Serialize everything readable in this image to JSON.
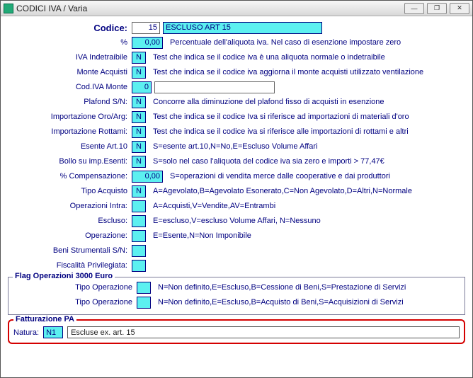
{
  "window": {
    "title": "CODICI IVA / Varia"
  },
  "header": {
    "codice_label": "Codice:",
    "codice_value": "15",
    "codice_desc": "ESCLUSO ART 15"
  },
  "rows": [
    {
      "label": "%",
      "value": "0,00",
      "hint": "Percentuale dell'aliquota iva. Nel caso di esenzione impostare zero",
      "w": "w44",
      "align": "right"
    },
    {
      "label": "IVA Indetraibile",
      "value": "N",
      "hint": "Test che indica se il codice iva è una aliquota normale o indetraibile",
      "w": "w20",
      "align": "center"
    },
    {
      "label": "Monte Acquisti",
      "value": "N",
      "hint": "Test che indica se il codice iva aggiorna il monte acquisti utilizzato ventilazione",
      "w": "w20",
      "align": "center"
    },
    {
      "label": "Cod.IVA Monte",
      "value": "0",
      "hint": "",
      "w": "w28",
      "align": "right",
      "extra_white": true
    },
    {
      "label": "Plafond S/N:",
      "value": "N",
      "hint": "Concorre alla diminuzione del plafond fisso di acquisti in esenzione",
      "w": "w20",
      "align": "center"
    },
    {
      "label": "Importazione Oro/Arg:",
      "value": "N",
      "hint": "Test che indica se il codice Iva si riferisce ad importazioni di materiali d'oro",
      "w": "w20",
      "align": "center"
    },
    {
      "label": "Importazione Rottami:",
      "value": "N",
      "hint": "Test che indica se il codice iva si riferisce alle importazioni di rottami e altri",
      "w": "w20",
      "align": "center"
    },
    {
      "label": "Esente Art.10",
      "value": "N",
      "hint": "S=esente art.10,N=No,E=Escluso Volume Affari",
      "w": "w20",
      "align": "center"
    },
    {
      "label": "Bollo su imp.Esenti:",
      "value": "N",
      "hint": "S=solo nel caso l'aliquota del codice iva sia zero e importi > 77,47€",
      "w": "w20",
      "align": "center"
    },
    {
      "label": "% Compensazione:",
      "value": "0,00",
      "hint": "S=operazioni di vendita merce dalle cooperative e dai produttori",
      "w": "w44",
      "align": "right"
    },
    {
      "label": "Tipo Acquisto",
      "value": "N",
      "hint": "A=Agevolato,B=Agevolato Esonerato,C=Non Agevolato,D=Altri,N=Normale",
      "w": "w20",
      "align": "center"
    },
    {
      "label": "Operazioni Intra:",
      "value": "",
      "hint": "A=Acquisti,V=Vendite,AV=Entrambi",
      "w": "w20",
      "align": "center"
    },
    {
      "label": "Escluso:",
      "value": "",
      "hint": "E=escluso,V=escluso Volume Affari, N=Nessuno",
      "w": "w20",
      "align": "center"
    },
    {
      "label": "Operazione:",
      "value": "",
      "hint": "E=Esente,N=Non Imponibile",
      "w": "w20",
      "align": "center"
    },
    {
      "label": "Beni Strumentali S/N:",
      "value": "",
      "hint": "",
      "w": "w20",
      "align": "center"
    },
    {
      "label": "Fiscalità Privilegiata:",
      "value": "",
      "hint": "",
      "w": "w20",
      "align": "center"
    }
  ],
  "group3000": {
    "legend": "Flag Operazioni 3000 Euro",
    "rows": [
      {
        "label": "Tipo Operazione",
        "value": "",
        "hint": "N=Non definito,E=Escluso,B=Cessione di Beni,S=Prestazione di Servizi"
      },
      {
        "label": "Tipo Operazione",
        "value": "",
        "hint": "N=Non definito,E=Escluso,B=Acquisto di Beni,S=Acquisizioni di Servizi"
      }
    ]
  },
  "fattpa": {
    "legend": "Fatturazione PA",
    "natura_label": "Natura:",
    "natura_code": "N1",
    "natura_desc": "Escluse ex. art. 15"
  }
}
